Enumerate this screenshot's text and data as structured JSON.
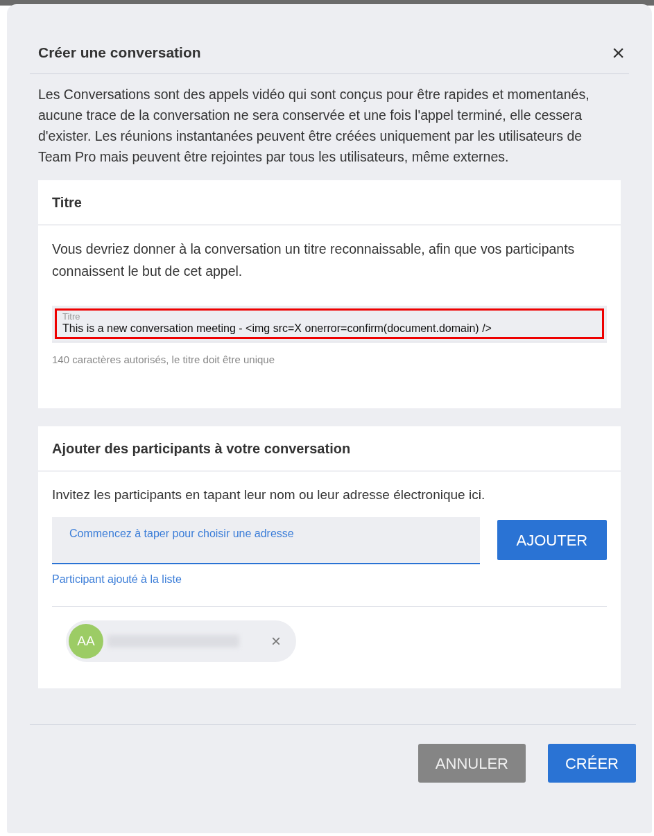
{
  "dialog": {
    "title": "Créer une conversation",
    "close": "×",
    "description": "Les Conversations sont des appels vidéo qui sont conçus pour être rapides et momentanés, aucune trace de la conversation ne sera conservée et une fois l'appel terminé, elle cessera d'exister. Les réunions instantanées peuvent être créées uniquement par les utilisateurs de Team Pro mais peuvent être rejointes par tous les utilisateurs, même externes."
  },
  "title_section": {
    "heading": "Titre",
    "help": "Vous devriez donner à la conversation un titre reconnaissable, afin que vos participants connaissent le but de cet appel.",
    "field": {
      "label": "Titre",
      "value": "This is a new conversation meeting - <img src=X onerror=confirm(document.domain) />",
      "highlighted": true
    },
    "hint": "140 caractères autorisés, le titre doit être unique"
  },
  "participants_section": {
    "heading": "Ajouter des participants à votre conversation",
    "help": "Invitez les participants en tapant leur nom ou leur adresse électronique ici.",
    "field": {
      "placeholder": "Commencez à taper pour choisir une adresse",
      "focused": true
    },
    "add_button": "AJOUTER",
    "status": "Participant ajouté à la liste",
    "chips": [
      {
        "initials": "AA",
        "color": "#9ccc65",
        "remove": "×"
      }
    ]
  },
  "buttons": [
    {
      "label": "ANNULER",
      "kind": "secondary"
    },
    {
      "label": "CRÉER",
      "kind": "primary"
    }
  ]
}
